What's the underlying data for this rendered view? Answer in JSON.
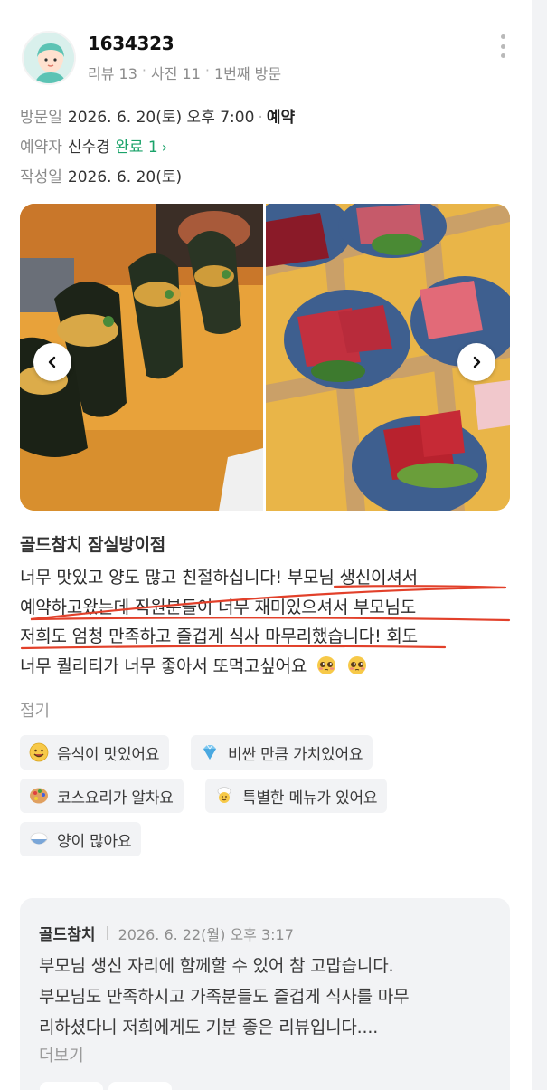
{
  "user": {
    "name": "1634323",
    "reviews": "리뷰 13",
    "photos": "사진 11",
    "visit_count": "1번째 방문"
  },
  "visit": {
    "label": "방문일",
    "date": "2026. 6. 20(토) 오후 7:00",
    "type": "예약"
  },
  "booker": {
    "label": "예약자",
    "name": "신수경",
    "status": "완료 1"
  },
  "written": {
    "label": "작성일",
    "date": "2026. 6. 20(토)"
  },
  "place_name": "골드참치 잠실방이점",
  "review_lines": [
    "너무 맛있고 양도 많고 친절하십니다! 부모님 생신이셔서",
    "예약하고왔는데 직원분들이 너무 재미있으셔서 부모님도",
    "저희도 엄청 만족하고 즐겁게 식사 마무리했습니다! 회도",
    "너무 퀄리티가 너무 좋아서 또먹고싶어요"
  ],
  "fold_label": "접기",
  "tags": [
    {
      "label": "음식이 맛있어요",
      "icon": "smile-face-icon"
    },
    {
      "label": "비싼 만큼 가치있어요",
      "icon": "diamond-icon"
    },
    {
      "label": "코스요리가 알차요",
      "icon": "palette-icon"
    },
    {
      "label": "특별한 메뉴가 있어요",
      "icon": "chef-icon"
    },
    {
      "label": "양이 많아요",
      "icon": "rice-bowl-icon"
    }
  ],
  "reply": {
    "name": "골드참치",
    "date": "2026. 6. 22(월) 오후 3:17",
    "lines": [
      "부모님 생신 자리에 함께할 수 있어 참 고맙습니다.",
      "부모님도 만족하시고 가족분들도 즐겁게 식사를 마무",
      "리하셨다니 저희에게도 기분 좋은 리뷰입니다...."
    ],
    "more_label": "더보기"
  },
  "colors": {
    "accent_green": "#1aa36a",
    "underline_red": "#e2402a",
    "panel_gray": "#f2f3f5"
  }
}
